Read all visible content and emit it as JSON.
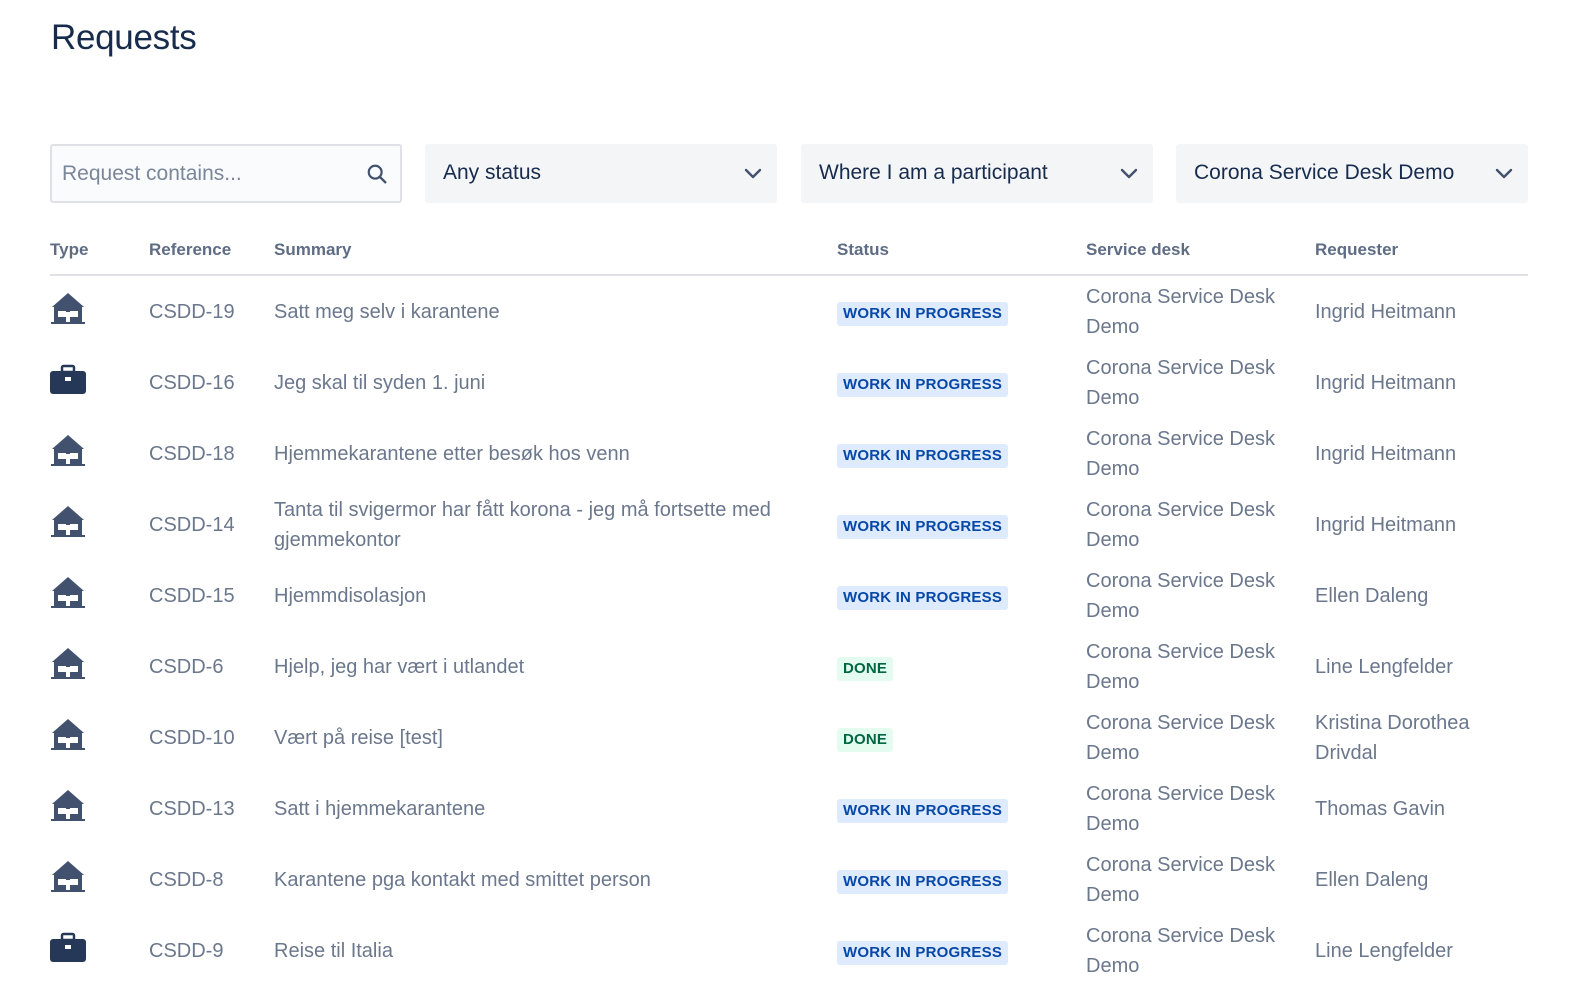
{
  "page": {
    "title": "Requests"
  },
  "filters": {
    "search_placeholder": "Request contains...",
    "status_value": "Any status",
    "participant_value": "Where I am a participant",
    "service_desk_value": "Corona Service Desk Demo"
  },
  "table": {
    "columns": [
      "Type",
      "Reference",
      "Summary",
      "Status",
      "Service desk",
      "Requester"
    ],
    "rows": [
      {
        "type": "house",
        "reference": "CSDD-19",
        "summary": "Satt meg selv i karantene",
        "status": "WORK IN PROGRESS",
        "status_kind": "wip",
        "service_desk": "Corona Service Desk Demo",
        "requester": "Ingrid Heitmann"
      },
      {
        "type": "briefcase",
        "reference": "CSDD-16",
        "summary": "Jeg skal til syden 1. juni",
        "status": "WORK IN PROGRESS",
        "status_kind": "wip",
        "service_desk": "Corona Service Desk Demo",
        "requester": "Ingrid Heitmann"
      },
      {
        "type": "house",
        "reference": "CSDD-18",
        "summary": "Hjemmekarantene etter besøk hos venn",
        "status": "WORK IN PROGRESS",
        "status_kind": "wip",
        "service_desk": "Corona Service Desk Demo",
        "requester": "Ingrid Heitmann"
      },
      {
        "type": "house",
        "reference": "CSDD-14",
        "summary": "Tanta til svigermor har fått korona - jeg må fortsette med gjemmekontor",
        "status": "WORK IN PROGRESS",
        "status_kind": "wip",
        "service_desk": "Corona Service Desk Demo",
        "requester": "Ingrid Heitmann"
      },
      {
        "type": "house",
        "reference": "CSDD-15",
        "summary": "Hjemmdisolasjon",
        "status": "WORK IN PROGRESS",
        "status_kind": "wip",
        "service_desk": "Corona Service Desk Demo",
        "requester": "Ellen Daleng"
      },
      {
        "type": "house",
        "reference": "CSDD-6",
        "summary": "Hjelp, jeg har vært i utlandet",
        "status": "DONE",
        "status_kind": "done",
        "service_desk": "Corona Service Desk Demo",
        "requester": "Line Lengfelder"
      },
      {
        "type": "house",
        "reference": "CSDD-10",
        "summary": "Vært på reise [test]",
        "status": "DONE",
        "status_kind": "done",
        "service_desk": "Corona Service Desk Demo",
        "requester": "Kristina Dorothea Drivdal"
      },
      {
        "type": "house",
        "reference": "CSDD-13",
        "summary": "Satt i hjemmekarantene",
        "status": "WORK IN PROGRESS",
        "status_kind": "wip",
        "service_desk": "Corona Service Desk Demo",
        "requester": "Thomas Gavin"
      },
      {
        "type": "house",
        "reference": "CSDD-8",
        "summary": "Karantene pga kontakt med smittet person",
        "status": "WORK IN PROGRESS",
        "status_kind": "wip",
        "service_desk": "Corona Service Desk Demo",
        "requester": "Ellen Daleng"
      },
      {
        "type": "briefcase",
        "reference": "CSDD-9",
        "summary": "Reise til Italia",
        "status": "WORK IN PROGRESS",
        "status_kind": "wip",
        "service_desk": "Corona Service Desk Demo",
        "requester": "Line Lengfelder"
      }
    ]
  },
  "icons": {
    "search": "search-icon",
    "dropdown": "chevron-down-icon",
    "house": "house-icon",
    "briefcase": "briefcase-icon"
  },
  "colors": {
    "wip_bg": "#deebff",
    "wip_text": "#0747a6",
    "done_bg": "#e3fcef",
    "done_text": "#006644"
  }
}
